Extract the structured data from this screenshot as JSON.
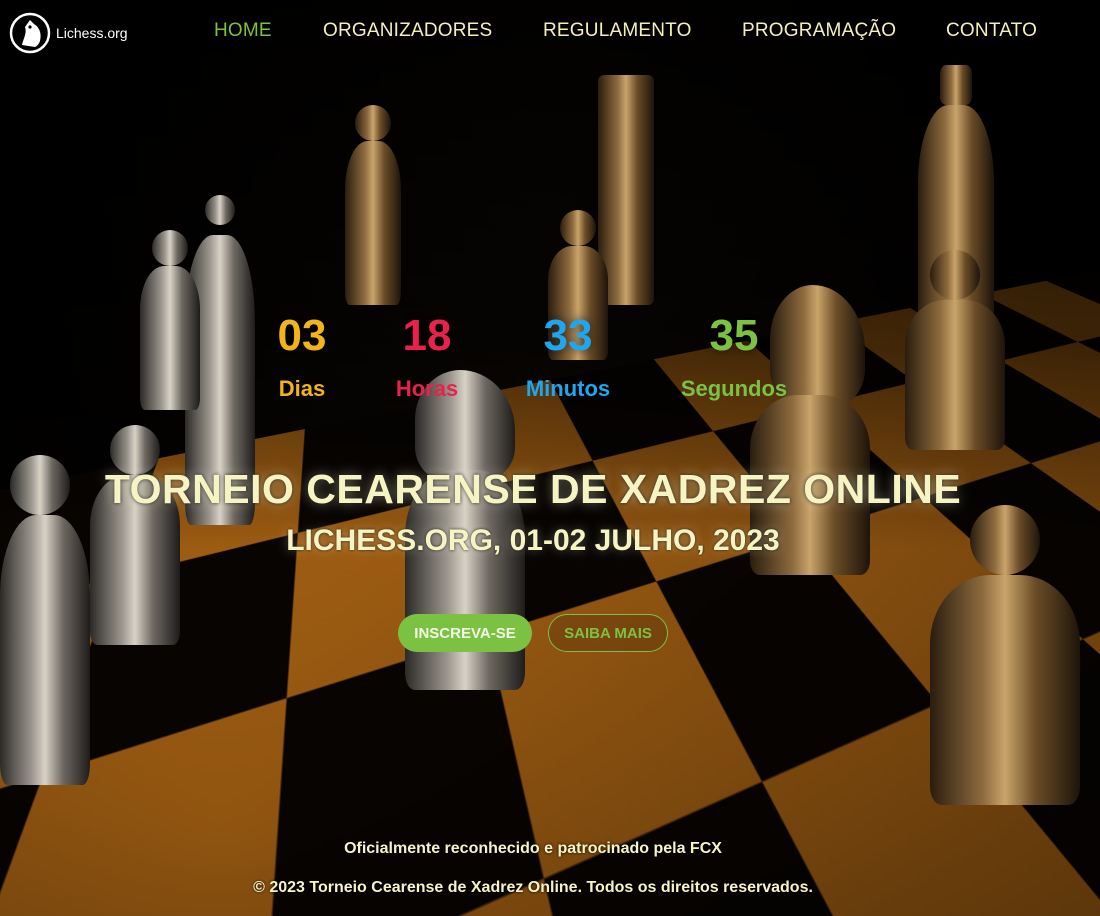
{
  "header": {
    "brand": "Lichess.org",
    "logo_icon": "knight-logo-icon",
    "nav": [
      {
        "label": "HOME",
        "active": true
      },
      {
        "label": "ORGANIZADORES",
        "active": false
      },
      {
        "label": "REGULAMENTO",
        "active": false
      },
      {
        "label": "PROGRAMAÇÃO",
        "active": false
      },
      {
        "label": "CONTATO",
        "active": false
      }
    ]
  },
  "countdown": [
    {
      "value": "03",
      "label": "Dias",
      "color": "#f2b418"
    },
    {
      "value": "18",
      "label": "Horas",
      "color": "#e8224a"
    },
    {
      "value": "33",
      "label": "Minutos",
      "color": "#1ea6f0"
    },
    {
      "value": "35",
      "label": "Segundos",
      "color": "#7cc242"
    }
  ],
  "hero": {
    "title": "TORNEIO CEARENSE DE XADREZ ONLINE",
    "subtitle": "LICHESS.ORG, 01-02 JULHO, 2023",
    "primary_button": "INSCREVA-SE",
    "secondary_button": "SAIBA MAIS"
  },
  "footer": {
    "sponsor": "Oficialmente reconhecido e patrocinado pela FCX",
    "copyright": "© 2023 Torneio Cearense de Xadrez Online. Todos os direitos reservados."
  },
  "colors": {
    "accent": "#7cc242",
    "nav_text": "#f4f1b8",
    "title_text": "#f7f4c4"
  }
}
